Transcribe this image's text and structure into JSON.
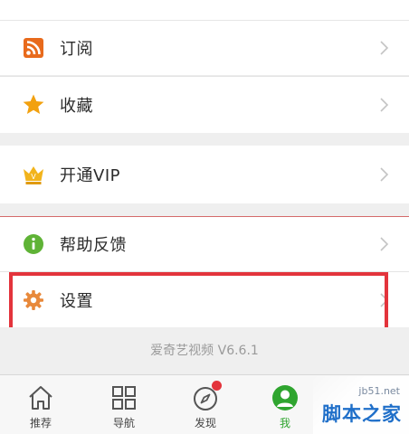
{
  "menu": {
    "items": [
      {
        "label": "订阅",
        "icon": "rss-icon"
      },
      {
        "label": "收藏",
        "icon": "star-icon"
      },
      {
        "label": "开通VIP",
        "icon": "crown-icon"
      },
      {
        "label": "帮助反馈",
        "icon": "info-icon"
      },
      {
        "label": "设置",
        "icon": "gear-icon"
      }
    ]
  },
  "footer": {
    "version": "爱奇艺视频 V6.6.1"
  },
  "tabbar": {
    "tabs": [
      {
        "label": "推荐",
        "icon": "home-icon"
      },
      {
        "label": "导航",
        "icon": "grid-icon"
      },
      {
        "label": "发现",
        "icon": "compass-icon",
        "badge": true
      },
      {
        "label": "我",
        "icon": "avatar-icon",
        "active": true
      }
    ]
  },
  "watermark": {
    "small": "jb51.net",
    "big": "脚本之家"
  },
  "colors": {
    "rss": "#e86a1c",
    "star": "#f2a10f",
    "crown": "#f2b41c",
    "info": "#5fb336",
    "gear": "#e8893b",
    "active": "#2fa52f",
    "highlight": "#e3343c"
  }
}
